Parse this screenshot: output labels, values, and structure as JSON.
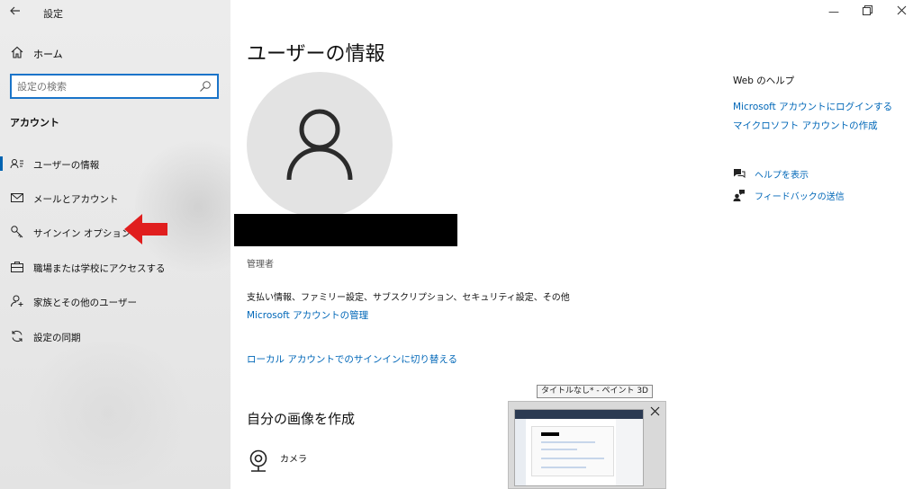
{
  "window": {
    "title": "設定"
  },
  "sidebar": {
    "home_label": "ホーム",
    "search_placeholder": "設定の検索",
    "section_title": "アカウント",
    "items": [
      {
        "label": "ユーザーの情報",
        "icon": "user-info-icon",
        "active": true
      },
      {
        "label": "メールとアカウント",
        "icon": "mail-icon",
        "active": false
      },
      {
        "label": "サインイン オプション",
        "icon": "key-icon",
        "active": false
      },
      {
        "label": "職場または学校にアクセスする",
        "icon": "briefcase-icon",
        "active": false
      },
      {
        "label": "家族とその他のユーザー",
        "icon": "person-add-icon",
        "active": false
      },
      {
        "label": "設定の同期",
        "icon": "sync-icon",
        "active": false
      }
    ]
  },
  "annotation": {
    "arrow_color": "#e01e1e"
  },
  "main": {
    "title": "ユーザーの情報",
    "role": "管理者",
    "description": "支払い情報、ファミリー設定、サブスクリプション、セキュリティ設定、その他",
    "manage_link": "Microsoft アカウントの管理",
    "local_link": "ローカル アカウントでのサインインに切り替える",
    "create_title": "自分の画像を作成",
    "camera_label": "カメラ"
  },
  "help": {
    "title": "Web のヘルプ",
    "links": [
      "Microsoft アカウントにログインする",
      "マイクロソフト アカウントの作成"
    ],
    "show_help": "ヘルプを表示",
    "feedback": "フィードバックの送信"
  },
  "taskbar_preview": {
    "tooltip": "タイトルなし* - ペイント 3D"
  },
  "colors": {
    "accent": "#0067b8",
    "search_border": "#1a74c9"
  }
}
